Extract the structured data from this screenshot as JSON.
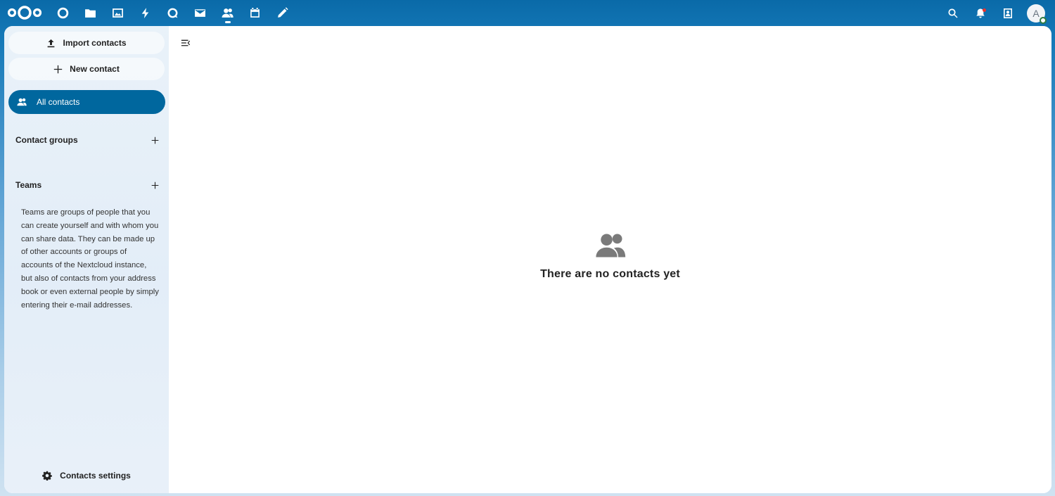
{
  "topbar": {
    "apps": [
      {
        "icon": "dashboard-icon"
      },
      {
        "icon": "files-icon"
      },
      {
        "icon": "photos-icon"
      },
      {
        "icon": "activity-icon"
      },
      {
        "icon": "talk-icon"
      },
      {
        "icon": "mail-icon"
      },
      {
        "icon": "contacts-icon",
        "active": true
      },
      {
        "icon": "calendar-icon"
      },
      {
        "icon": "notes-icon"
      }
    ],
    "right": [
      "search-icon",
      "notifications-icon",
      "contacts-menu-icon"
    ],
    "avatar_initial": "A"
  },
  "sidebar": {
    "import_label": "Import contacts",
    "new_label": "New contact",
    "all_contacts_label": "All contacts",
    "groups_label": "Contact groups",
    "teams_label": "Teams",
    "teams_description": "Teams are groups of people that you can create yourself and with whom you can share data. They can be made up of other accounts or groups of accounts of the Nextcloud instance, but also of contacts from your address book or even external people by simply entering their e-mail addresses.",
    "settings_label": "Contacts settings"
  },
  "main": {
    "empty_message": "There are no contacts yet"
  },
  "colors": {
    "brand": "#00679e",
    "empty_icon": "#7a7a7a"
  }
}
